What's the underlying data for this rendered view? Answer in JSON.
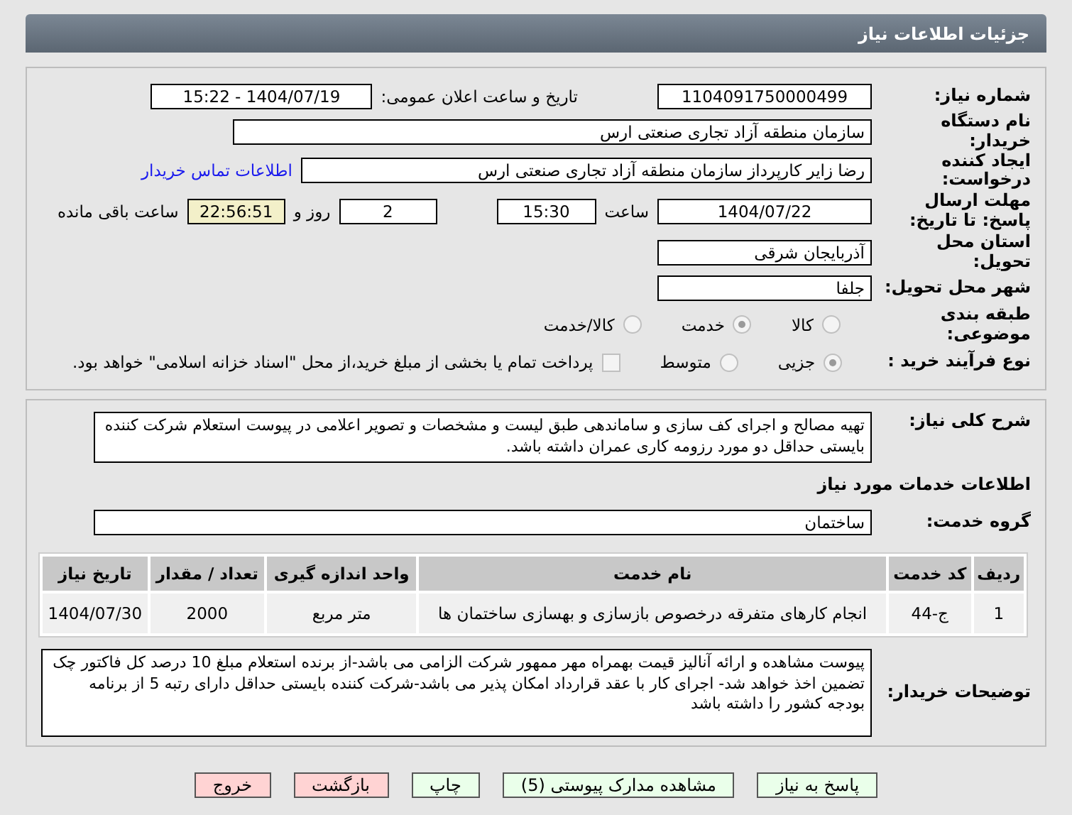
{
  "title": "جزئیات اطلاعات نیاز",
  "need_number": {
    "label": "شماره نیاز:",
    "value": "1104091750000499"
  },
  "announce": {
    "label": "تاریخ و ساعت اعلان عمومی:",
    "value": "1404/07/19 - 15:22"
  },
  "buyer": {
    "label": "نام دستگاه خریدار:",
    "value": "سازمان منطقه آزاد تجاری صنعتی ارس"
  },
  "requester": {
    "label": "ایجاد کننده درخواست:",
    "value": "رضا زایر کارپرداز سازمان منطقه آزاد تجاری صنعتی ارس",
    "link": "اطلاعات تماس خریدار"
  },
  "deadline": {
    "label": "مهلت ارسال پاسخ: تا تاریخ:",
    "date": "1404/07/22",
    "time_label": "ساعت",
    "time": "15:30",
    "days": "2",
    "days_label": "روز و",
    "remaining": "22:56:51",
    "remaining_label": "ساعت باقی مانده"
  },
  "province": {
    "label": "استان محل تحویل:",
    "value": "آذربایجان شرقی"
  },
  "city": {
    "label": "شهر محل تحویل:",
    "value": "جلفا"
  },
  "category": {
    "label": "طبقه بندی موضوعی:",
    "options": [
      {
        "label": "کالا",
        "selected": false
      },
      {
        "label": "خدمت",
        "selected": true
      },
      {
        "label": "کالا/خدمت",
        "selected": false
      }
    ]
  },
  "process": {
    "label": "نوع فرآیند خرید :",
    "options": [
      {
        "label": "جزیی",
        "selected": true
      },
      {
        "label": "متوسط",
        "selected": false
      }
    ],
    "payment": {
      "label": "پرداخت تمام یا بخشی از مبلغ خرید،از محل \"اسناد خزانه اسلامی\" خواهد بود.",
      "checked": false
    }
  },
  "description": {
    "label": "شرح کلی نیاز:",
    "value": "تهیه مصالح و اجرای کف سازی و ساماندهی طبق لیست و مشخصات و تصویر اعلامی در پیوست استعلام شرکت کننده بایستی حداقل دو مورد رزومه کاری عمران داشته باشد."
  },
  "services_heading": "اطلاعات خدمات مورد نیاز",
  "service_group": {
    "label": "گروه خدمت:",
    "value": "ساختمان"
  },
  "table": {
    "columns": [
      "ردیف",
      "کد خدمت",
      "نام خدمت",
      "واحد اندازه گیری",
      "تعداد / مقدار",
      "تاریخ نیاز"
    ],
    "rows": [
      [
        "1",
        "ج-44",
        "انجام کارهای متفرقه درخصوص بازسازی و بهسازی ساختمان ها",
        "متر مربع",
        "2000",
        "1404/07/30"
      ]
    ]
  },
  "notes": {
    "label": "توضیحات خریدار:",
    "value": "پیوست مشاهده و ارائه آنالیز قیمت بهمراه مهر ممهور شرکت الزامی می باشد-از برنده استعلام مبلغ 10 درصد کل فاکتور چک تضمین اخذ خواهد شد- اجرای کار با عقد قرارداد امکان پذیر می باشد-شرکت کننده بایستی حداقل دارای رتبه 5 از برنامه بودجه کشور را داشته باشد"
  },
  "buttons": [
    {
      "label": "پاسخ به نیاز",
      "kind": "go"
    },
    {
      "label": "مشاهده مدارک پیوستی (5)",
      "kind": "go"
    },
    {
      "label": "چاپ",
      "kind": "go"
    },
    {
      "label": "بازگشت",
      "kind": "stop"
    },
    {
      "label": "خروج",
      "kind": "stop"
    }
  ]
}
